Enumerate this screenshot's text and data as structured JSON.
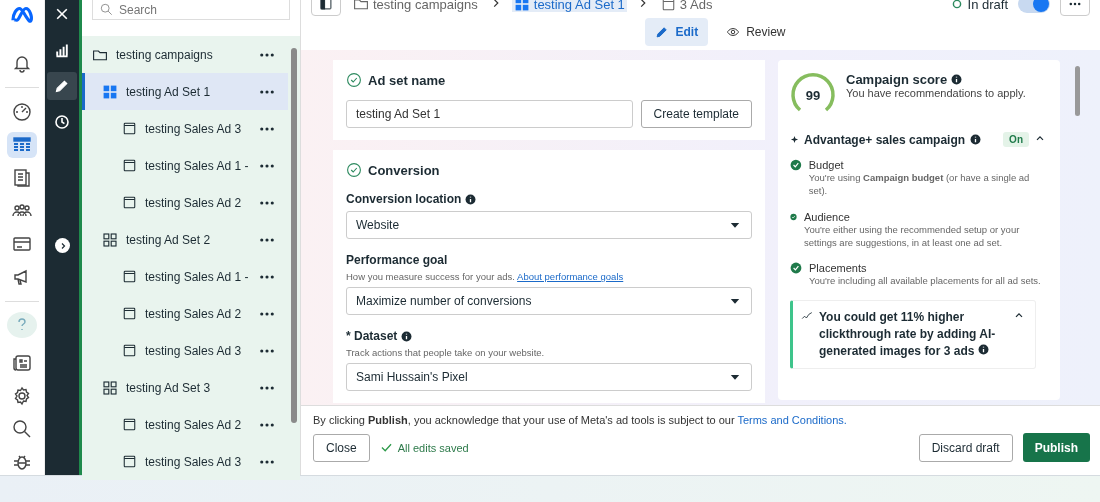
{
  "rail": [
    {
      "kind": "bell",
      "selected": false
    },
    {
      "kind": "gauge",
      "selected": false
    },
    {
      "kind": "table",
      "selected": true
    },
    {
      "kind": "pages",
      "selected": false
    },
    {
      "kind": "people",
      "selected": false
    },
    {
      "kind": "card",
      "selected": false
    },
    {
      "kind": "megaphone",
      "selected": false
    },
    {
      "kind": "help",
      "selected": false
    },
    {
      "kind": "news",
      "selected": false
    },
    {
      "kind": "gear",
      "selected": false
    },
    {
      "kind": "search",
      "selected": false
    },
    {
      "kind": "bug",
      "selected": false
    }
  ],
  "dark_rail": [
    {
      "kind": "close",
      "selected": false
    },
    {
      "kind": "chart",
      "selected": false
    },
    {
      "kind": "edit",
      "selected": true
    },
    {
      "kind": "history",
      "selected": false
    }
  ],
  "search": {
    "placeholder": "Search"
  },
  "tree": [
    {
      "label": "testing campaigns",
      "kind": "campaign",
      "selected": false,
      "children": [
        {
          "label": "testing Ad Set 1",
          "kind": "adset",
          "selected": true,
          "children": [
            {
              "label": "testing Sales Ad 3",
              "kind": "ad",
              "selected": false
            },
            {
              "label": "testing Sales Ad 1 -",
              "kind": "ad",
              "selected": false
            },
            {
              "label": "testing Sales Ad 2",
              "kind": "ad",
              "selected": false
            }
          ]
        },
        {
          "label": "testing Ad Set 2",
          "kind": "adset",
          "selected": false,
          "children": [
            {
              "label": "testing Sales Ad 1 -",
              "kind": "ad",
              "selected": false
            },
            {
              "label": "testing Sales Ad 2",
              "kind": "ad",
              "selected": false
            },
            {
              "label": "testing Sales Ad 3",
              "kind": "ad",
              "selected": false
            }
          ]
        },
        {
          "label": "testing Ad Set 3",
          "kind": "adset",
          "selected": false,
          "children": [
            {
              "label": "testing Sales Ad 2",
              "kind": "ad",
              "selected": false
            },
            {
              "label": "testing Sales Ad 3",
              "kind": "ad",
              "selected": false
            }
          ]
        }
      ]
    }
  ],
  "breadcrumb": [
    {
      "label": "testing campaigns",
      "kind": "campaign",
      "selected": false
    },
    {
      "label": "testing Ad Set 1",
      "kind": "adset",
      "selected": true
    },
    {
      "label": "3 Ads",
      "kind": "ad",
      "selected": false
    }
  ],
  "status": {
    "label": "In draft",
    "on": true
  },
  "mode_tabs": [
    {
      "label": "Edit",
      "kind": "edit",
      "selected": true
    },
    {
      "label": "Review",
      "kind": "eye",
      "selected": false
    }
  ],
  "ad_set_name": {
    "title": "Ad set name",
    "value": "testing Ad Set 1",
    "button": "Create template"
  },
  "conversion": {
    "title": "Conversion",
    "fields": [
      {
        "label": "Conversion location",
        "info": true,
        "value": "Website"
      },
      {
        "label": "Performance goal",
        "info": false,
        "help": "How you measure success for your ads.",
        "link": "About performance goals",
        "value": "Maximize number of conversions"
      },
      {
        "label": "* Dataset",
        "info": true,
        "help": "Track actions that people take on your website.",
        "value": "Sami Hussain's Pixel"
      }
    ]
  },
  "score": {
    "value": "99",
    "title": "Campaign score",
    "subtitle": "You have recommendations to apply.",
    "advantage": {
      "title": "Advantage+ sales campaign",
      "badge": "On",
      "expanded": true
    },
    "items": [
      {
        "title": "Budget",
        "text": "You're using **Campaign budget** (or have a single ad set)."
      },
      {
        "title": "Audience",
        "text": "You're either using the recommended setup or your settings are suggestions, in at least one ad set."
      },
      {
        "title": "Placements",
        "text": "You're including all available placements for all ad sets."
      }
    ],
    "tip": {
      "text": "You could get 11% higher clickthrough rate by adding AI-generated images for 3 ads",
      "expanded": true
    }
  },
  "footer": {
    "notice": "By clicking **Publish**, you acknowledge that your use of Meta's ad tools is subject to our",
    "link": "Terms and Conditions.",
    "close": "Close",
    "saved": "All edits saved",
    "discard": "Discard draft",
    "publish": "Publish"
  }
}
